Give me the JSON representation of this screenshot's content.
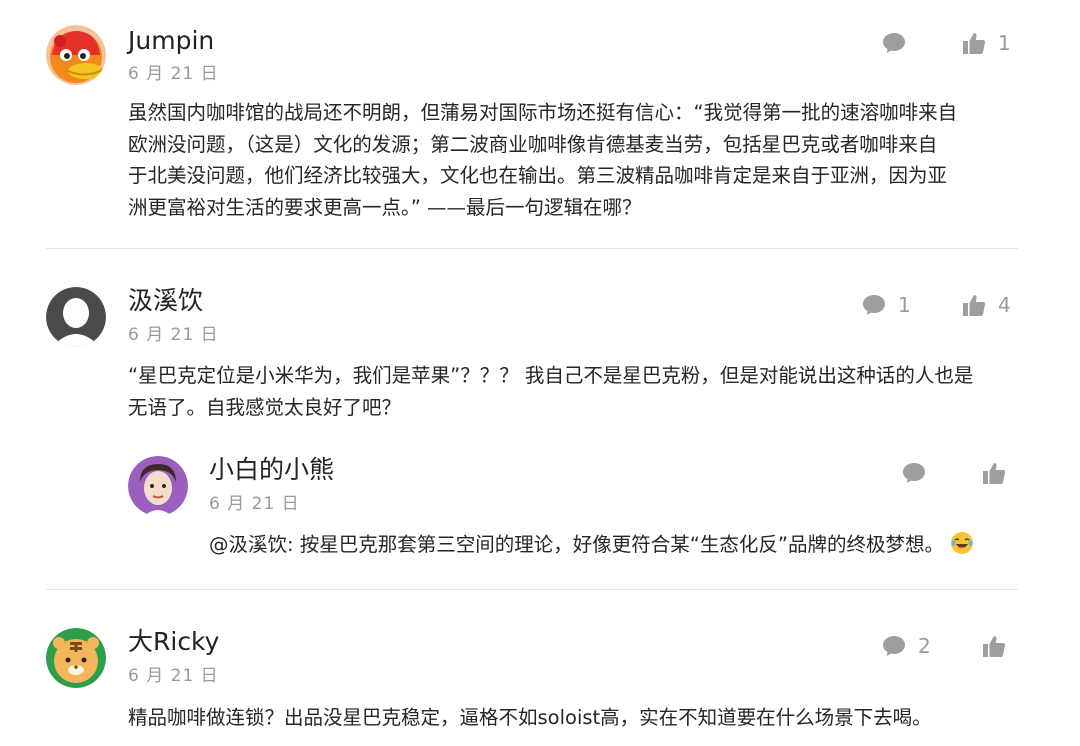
{
  "comments": [
    {
      "author": "Jumpin",
      "date": "6 月 21 日",
      "lines": [
        "虽然国内咖啡馆的战局还不明朗，但蒲易对国际市场还挺有信心：“我觉得第一批的速溶咖啡来自",
        "欧洲没问题，（这是）文化的发源；第二波商业咖啡像肯德基麦当劳，包括星巴克或者咖啡来自",
        "于北美没问题，他们经济比较强大，文化也在输出。第三波精品咖啡肯定是来自于亚洲，因为亚",
        "洲更富裕对生活的要求更高一点。” ——最后一句逻辑在哪？"
      ],
      "reply_count": "",
      "like_count": "1",
      "avatar_icon": "duck-avatar-icon"
    },
    {
      "author": "汲溪饮",
      "date": "6 月 21 日",
      "lines": [
        "“星巴克定位是小米华为，我们是苹果”？？？ 我自己不是星巴克粉，但是对能说出这种话的人也是",
        "无语了。自我感觉太良好了吧？"
      ],
      "reply_count": "1",
      "like_count": "4",
      "avatar_icon": "default-user-avatar-icon",
      "replies": [
        {
          "author": "小白的小熊",
          "date": "6 月 21 日",
          "text": "@汲溪饮: 按星巴克那套第三空间的理论，好像更符合某“生态化反”品牌的终极梦想。",
          "emoji_icon": "laughing-tears-emoji-icon",
          "reply_count": "",
          "like_count": "",
          "avatar_icon": "cartoon-face-avatar-icon"
        }
      ]
    },
    {
      "author": "大Ricky",
      "date": "6 月 21 日",
      "lines": [
        "精品咖啡做连锁？出品没星巴克稳定，逼格不如soloist高，实在不知道要在什么场景下去喝。"
      ],
      "reply_count": "2",
      "like_count": "",
      "avatar_icon": "tiger-avatar-icon"
    }
  ],
  "colors": {
    "icon_gray": "#9e9e9e",
    "text": "#262626",
    "date": "#9a9a9a",
    "divider": "#e6e6e6"
  }
}
